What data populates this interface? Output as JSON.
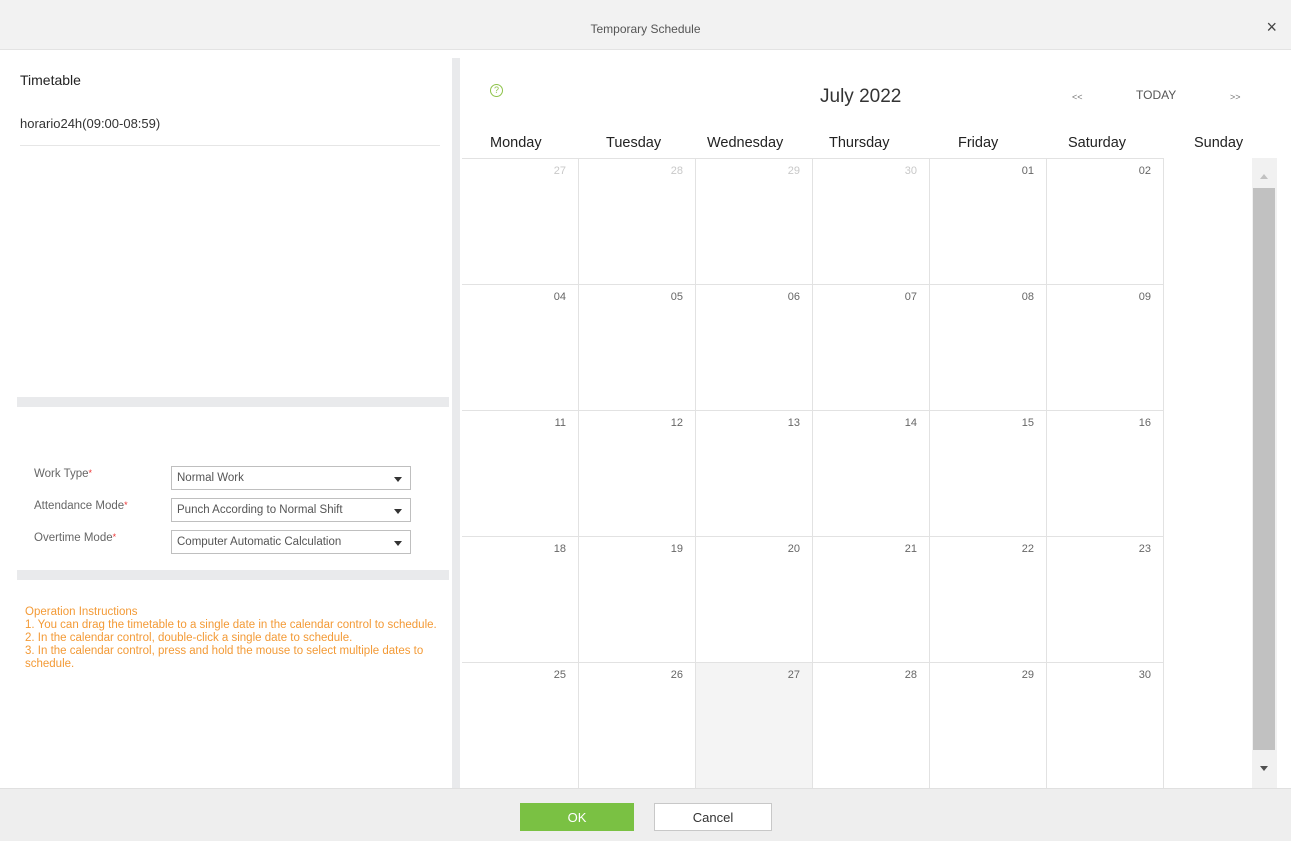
{
  "dialog": {
    "title": "Temporary Schedule",
    "close_glyph": "×"
  },
  "timetable": {
    "title": "Timetable",
    "items": [
      "horario24h(09:00-08:59)"
    ]
  },
  "form": {
    "work_type": {
      "label": "Work Type",
      "value": "Normal Work"
    },
    "attendance_mode": {
      "label": "Attendance Mode",
      "value": "Punch According to Normal Shift"
    },
    "overtime_mode": {
      "label": "Overtime Mode",
      "value": "Computer Automatic Calculation"
    },
    "required_mark": "*"
  },
  "instructions": {
    "heading": "Operation Instructions",
    "lines": [
      "1. You can drag the timetable to a single date in the calendar control to schedule.",
      "2. In the calendar control, double-click a single date to schedule.",
      "3. In the calendar control, press and hold the mouse to select multiple dates to schedule."
    ]
  },
  "calendar": {
    "month_label": "July 2022",
    "prev_label": "<<",
    "today_label": "TODAY",
    "next_label": ">>",
    "help_icon": "help-circle-icon",
    "weekdays": [
      "Monday",
      "Tuesday",
      "Wednesday",
      "Thursday",
      "Friday",
      "Saturday",
      "Sunday"
    ],
    "weeks": [
      [
        "27",
        "28",
        "29",
        "30",
        "01",
        "02"
      ],
      [
        "04",
        "05",
        "06",
        "07",
        "08",
        "09"
      ],
      [
        "11",
        "12",
        "13",
        "14",
        "15",
        "16"
      ],
      [
        "18",
        "19",
        "20",
        "21",
        "22",
        "23"
      ],
      [
        "25",
        "26",
        "27",
        "28",
        "29",
        "30"
      ]
    ],
    "other_month_days": [
      [
        0,
        0
      ],
      [
        0,
        1
      ],
      [
        0,
        2
      ],
      [
        0,
        3
      ]
    ],
    "highlighted_day": [
      4,
      2
    ]
  },
  "footer": {
    "ok_label": "OK",
    "cancel_label": "Cancel"
  },
  "colors": {
    "accent_green": "#7ac143",
    "instruction_orange": "#f39a36"
  }
}
